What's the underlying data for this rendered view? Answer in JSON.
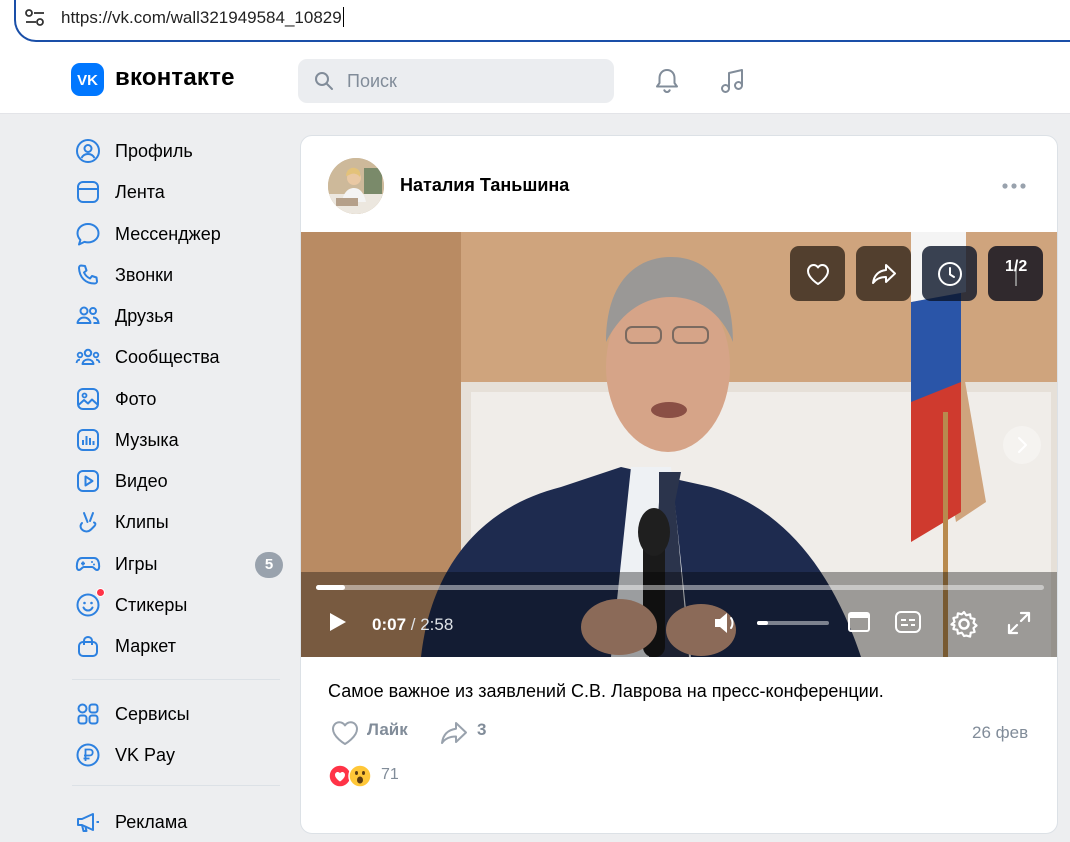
{
  "browser": {
    "url": "https://vk.com/wall321949584_10829"
  },
  "header": {
    "logo_text": "вконтакте",
    "search_placeholder": "Поиск"
  },
  "sidebar": {
    "items": [
      {
        "label": "Профиль",
        "icon": "profile-icon"
      },
      {
        "label": "Лента",
        "icon": "feed-icon"
      },
      {
        "label": "Мессенджер",
        "icon": "messenger-icon"
      },
      {
        "label": "Звонки",
        "icon": "phone-icon"
      },
      {
        "label": "Друзья",
        "icon": "friends-icon"
      },
      {
        "label": "Сообщества",
        "icon": "communities-icon"
      },
      {
        "label": "Фото",
        "icon": "photo-icon"
      },
      {
        "label": "Музыка",
        "icon": "music-icon"
      },
      {
        "label": "Видео",
        "icon": "video-icon"
      },
      {
        "label": "Клипы",
        "icon": "clips-icon"
      },
      {
        "label": "Игры",
        "icon": "games-icon",
        "badge": "5"
      },
      {
        "label": "Стикеры",
        "icon": "stickers-icon",
        "notification_dot": true
      },
      {
        "label": "Маркет",
        "icon": "market-icon"
      },
      {
        "label": "Сервисы",
        "icon": "services-icon"
      },
      {
        "label": "VK Pay",
        "icon": "vkpay-icon"
      },
      {
        "label": "Реклама",
        "icon": "ads-icon"
      }
    ]
  },
  "post": {
    "author": "Наталия Таньшина",
    "video": {
      "counter": "1/2",
      "current_time": "0:07",
      "total_time": "/ 2:58",
      "progress": 0.04,
      "volume": 0.15
    },
    "caption": "Самое важное из заявлений С.В. Лаврова на пресс-конференции.",
    "like_label": "Лайк",
    "share_count": "3",
    "date": "26 фев",
    "reactions_count": "71"
  },
  "colors": {
    "accent": "#0077ff",
    "background": "#edeef0",
    "secondary_text": "#818c99",
    "badge": "#99a2ad",
    "dot": "#ff3347"
  }
}
